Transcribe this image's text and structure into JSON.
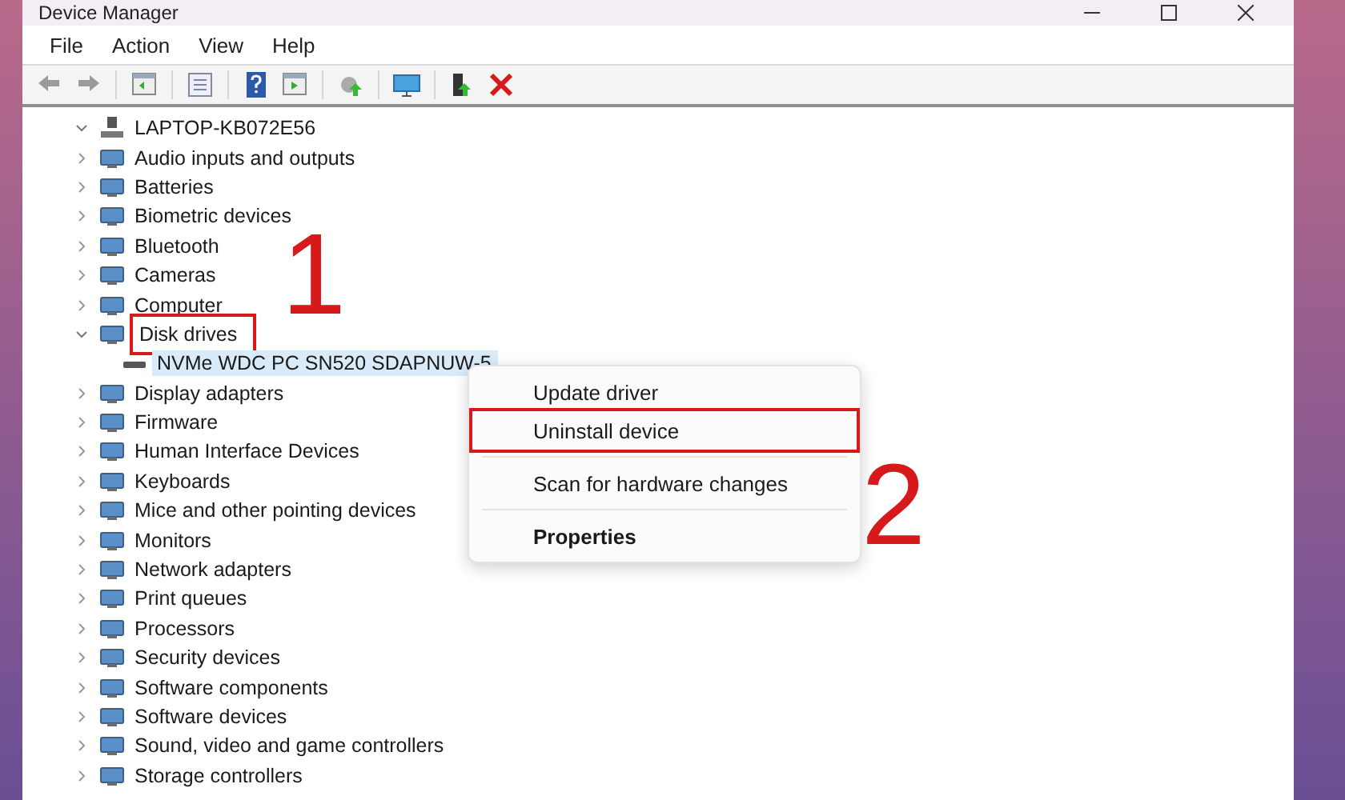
{
  "window": {
    "title": "Device Manager"
  },
  "menu": [
    "File",
    "Action",
    "View",
    "Help"
  ],
  "tree": {
    "label": "LAPTOP-KB072E56",
    "expanded": true,
    "children": [
      {
        "label": "Audio inputs and outputs",
        "expanded": false,
        "selected": false,
        "marked": false
      },
      {
        "label": "Batteries",
        "expanded": false,
        "selected": false,
        "marked": false
      },
      {
        "label": "Biometric devices",
        "expanded": false,
        "selected": false,
        "marked": false
      },
      {
        "label": "Bluetooth",
        "expanded": false,
        "selected": false,
        "marked": false
      },
      {
        "label": "Cameras",
        "expanded": false,
        "selected": false,
        "marked": false
      },
      {
        "label": "Computer",
        "expanded": false,
        "selected": false,
        "marked": false
      },
      {
        "label": "Disk drives",
        "expanded": true,
        "selected": false,
        "marked": true,
        "children": [
          {
            "label": "NVMe WDC PC SN520 SDAPNUW-5",
            "selected": true,
            "marked": false
          }
        ]
      },
      {
        "label": "Display adapters",
        "expanded": false,
        "selected": false,
        "marked": false
      },
      {
        "label": "Firmware",
        "expanded": false,
        "selected": false,
        "marked": false
      },
      {
        "label": "Human Interface Devices",
        "expanded": false,
        "selected": false,
        "marked": false
      },
      {
        "label": "Keyboards",
        "expanded": false,
        "selected": false,
        "marked": false
      },
      {
        "label": "Mice and other pointing devices",
        "expanded": false,
        "selected": false,
        "marked": false
      },
      {
        "label": "Monitors",
        "expanded": false,
        "selected": false,
        "marked": false
      },
      {
        "label": "Network adapters",
        "expanded": false,
        "selected": false,
        "marked": false
      },
      {
        "label": "Print queues",
        "expanded": false,
        "selected": false,
        "marked": false
      },
      {
        "label": "Processors",
        "expanded": false,
        "selected": false,
        "marked": false
      },
      {
        "label": "Security devices",
        "expanded": false,
        "selected": false,
        "marked": false
      },
      {
        "label": "Software components",
        "expanded": false,
        "selected": false,
        "marked": false
      },
      {
        "label": "Software devices",
        "expanded": false,
        "selected": false,
        "marked": false
      },
      {
        "label": "Sound, video and game controllers",
        "expanded": false,
        "selected": false,
        "marked": false
      },
      {
        "label": "Storage controllers",
        "expanded": false,
        "selected": false,
        "marked": false
      }
    ]
  },
  "context_menu": [
    {
      "label": "Update driver",
      "bold": false,
      "marked": false,
      "separator_after": false
    },
    {
      "label": "Uninstall device",
      "bold": false,
      "marked": true,
      "separator_after": true
    },
    {
      "label": "Scan for hardware changes",
      "bold": false,
      "marked": false,
      "separator_after": true
    },
    {
      "label": "Properties",
      "bold": true,
      "marked": false,
      "separator_after": false
    }
  ],
  "annotations": [
    "1",
    "2"
  ]
}
